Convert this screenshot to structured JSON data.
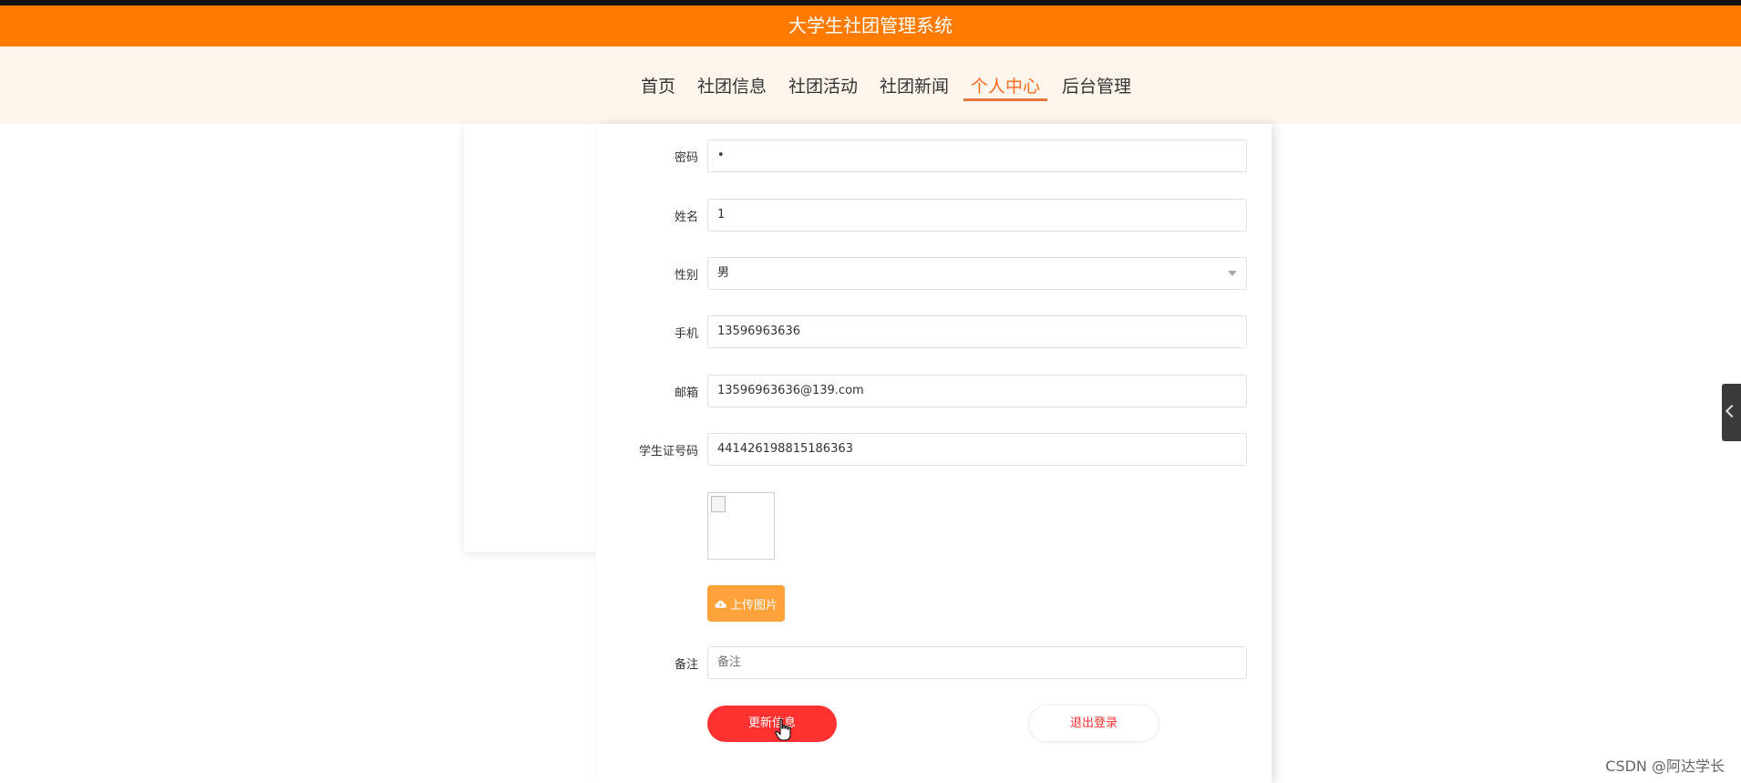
{
  "header": {
    "title": "大学生社团管理系统"
  },
  "nav": {
    "items": [
      {
        "label": "首页"
      },
      {
        "label": "社团信息"
      },
      {
        "label": "社团活动"
      },
      {
        "label": "社团新闻"
      },
      {
        "label": "个人中心"
      },
      {
        "label": "后台管理"
      }
    ],
    "active": "个人中心"
  },
  "form": {
    "password": {
      "label": "密码",
      "value": "•"
    },
    "name": {
      "label": "姓名",
      "value": "1"
    },
    "gender": {
      "label": "性别",
      "value": "男"
    },
    "phone": {
      "label": "手机",
      "value": "13596963636"
    },
    "email": {
      "label": "邮箱",
      "value": "13596963636@139.com"
    },
    "student_id": {
      "label": "学生证号码",
      "value": "441426198815186363"
    },
    "upload_label": "上传图片",
    "remark": {
      "label": "备注",
      "placeholder": "备注"
    },
    "update_label": "更新信息",
    "logout_label": "退出登录"
  },
  "watermark": "CSDN @阿达学长",
  "colors": {
    "header": "#ff7b00",
    "nav_bg": "#fef6ed",
    "active": "#ff6a1c",
    "update": "#ff3131",
    "upload": "#ffa23a"
  }
}
